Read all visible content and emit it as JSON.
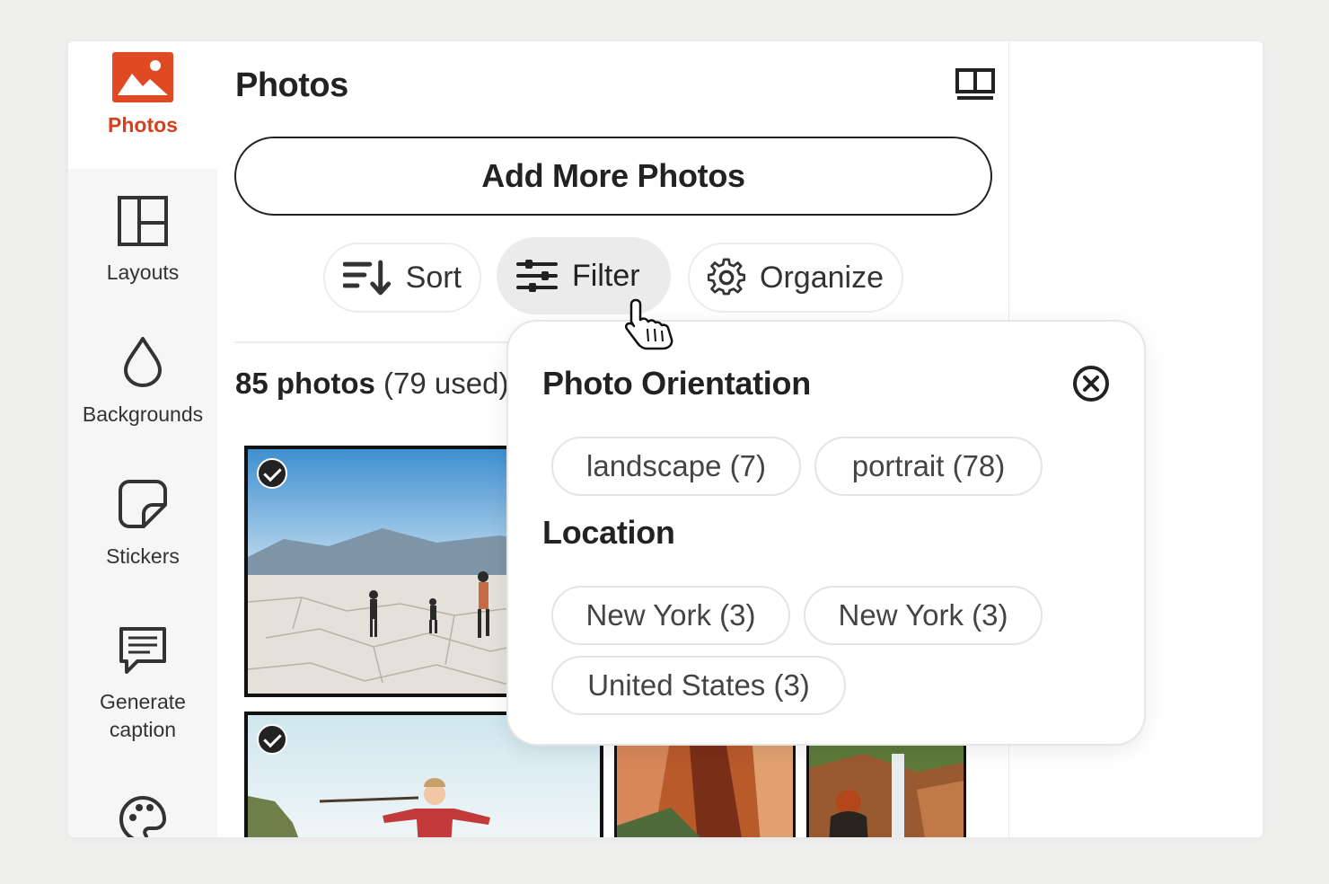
{
  "sidebar": {
    "items": [
      {
        "label": "Photos",
        "icon": "photo-icon",
        "active": true
      },
      {
        "label": "Layouts",
        "icon": "layouts-icon"
      },
      {
        "label": "Backgrounds",
        "icon": "drop-icon"
      },
      {
        "label": "Stickers",
        "icon": "sticker-icon"
      },
      {
        "label": "Generate caption",
        "label_line1": "Generate",
        "label_line2": "caption",
        "icon": "caption-icon"
      },
      {
        "label": "",
        "icon": "palette-icon"
      }
    ],
    "accent": "#d5411c"
  },
  "panel": {
    "title": "Photos",
    "add_button": "Add More Photos",
    "toolbar": {
      "sort_label": "Sort",
      "filter_label": "Filter",
      "organize_label": "Organize"
    },
    "count_strong": "85 photos",
    "count_used": "(79 used)"
  },
  "filter_popover": {
    "orientation_heading": "Photo Orientation",
    "orientation_chips": [
      "landscape (7)",
      "portrait (78)"
    ],
    "location_heading": "Location",
    "location_chips": [
      "New York (3)",
      "New York (3)",
      "United States (3)"
    ]
  }
}
